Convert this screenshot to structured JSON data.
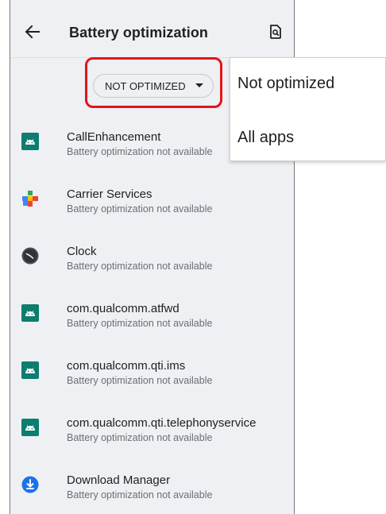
{
  "header": {
    "title": "Battery optimization",
    "back_icon": "arrow-left-icon",
    "search_icon": "search-in-page-icon"
  },
  "filter": {
    "selected": "NOT OPTIMIZED",
    "highlight_color": "#e3141b"
  },
  "dropdown": {
    "options": [
      "Not optimized",
      "All apps"
    ]
  },
  "apps": [
    {
      "name": "CallEnhancement",
      "status": "Battery optimization not available",
      "icon": "android-icon"
    },
    {
      "name": "Carrier Services",
      "status": "Battery optimization not available",
      "icon": "carrier-services-icon"
    },
    {
      "name": "Clock",
      "status": "Battery optimization not available",
      "icon": "clock-icon"
    },
    {
      "name": "com.qualcomm.atfwd",
      "status": "Battery optimization not available",
      "icon": "android-icon"
    },
    {
      "name": "com.qualcomm.qti.ims",
      "status": "Battery optimization not available",
      "icon": "android-icon"
    },
    {
      "name": "com.qualcomm.qti.telephonyservice",
      "status": "Battery optimization not available",
      "icon": "android-icon"
    },
    {
      "name": "Download Manager",
      "status": "Battery optimization not available",
      "icon": "download-icon"
    }
  ]
}
